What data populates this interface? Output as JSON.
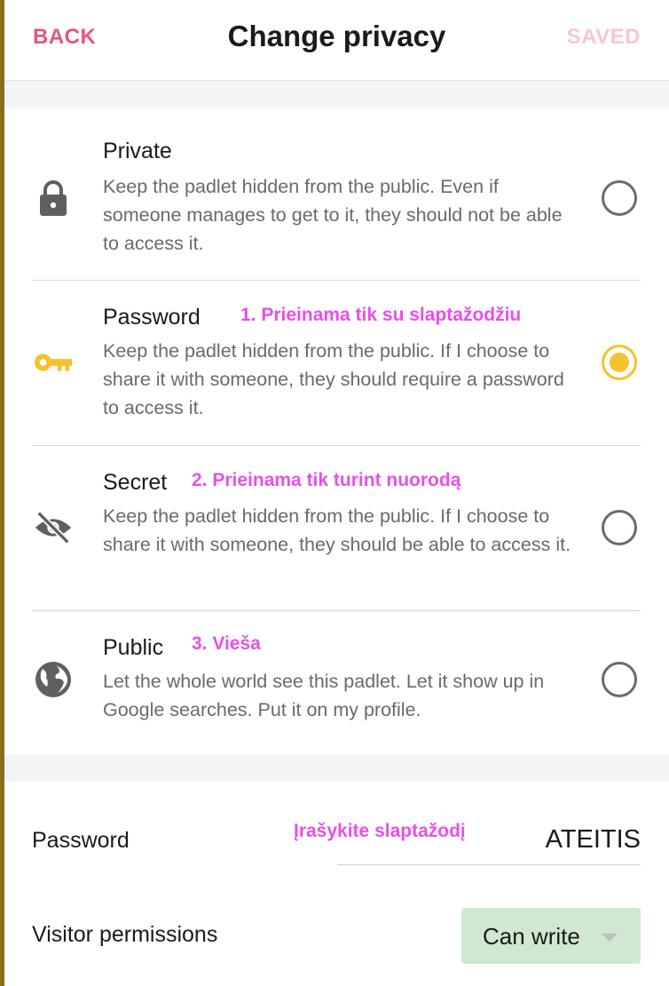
{
  "header": {
    "back_label": "BACK",
    "title": "Change privacy",
    "saved_label": "SAVED"
  },
  "options": [
    {
      "title": "Private",
      "icon": "lock-icon",
      "description": "Keep the padlet hidden from the public. Even if someone manages to get to it, they should not be able to access it.",
      "annotation": "",
      "selected": false
    },
    {
      "title": "Password",
      "icon": "key-icon",
      "description": "Keep the padlet hidden from the public. If I choose to share it with someone, they should require a password to access it.",
      "annotation": "1. Prieinama tik su slaptažodžiu",
      "selected": true
    },
    {
      "title": "Secret",
      "icon": "eye-off-icon",
      "description": "Keep the padlet hidden from the public. If I choose to share it with someone, they should be able to access it.",
      "annotation": "2. Prieinama tik turint nuorodą",
      "selected": false
    },
    {
      "title": "Public",
      "icon": "globe-icon",
      "description": "Let the whole world see this padlet. Let it show up in Google searches. Put it on my profile.",
      "annotation": "3. Vieša",
      "selected": false
    }
  ],
  "password": {
    "label": "Password",
    "annotation": "Įrašykite slaptažodį",
    "value": "ATEITIS"
  },
  "permissions": {
    "label": "Visitor permissions",
    "selected": "Can write"
  },
  "colors": {
    "accent_pink": "#e8547a",
    "selected_yellow": "#f7c12b",
    "annotation_magenta": "#e84fe8",
    "select_green": "#cfe8cf"
  }
}
